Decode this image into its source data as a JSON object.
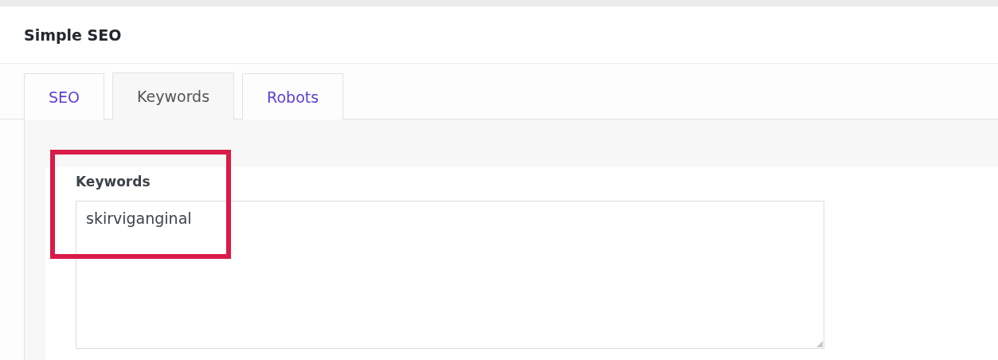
{
  "panel": {
    "title": "Simple SEO"
  },
  "tabs": [
    {
      "label": "SEO",
      "selected": false
    },
    {
      "label": "Keywords",
      "selected": true
    },
    {
      "label": "Robots",
      "selected": false
    }
  ],
  "keywords": {
    "label": "Keywords",
    "value": "skirviganginal",
    "highlighted": true
  }
}
